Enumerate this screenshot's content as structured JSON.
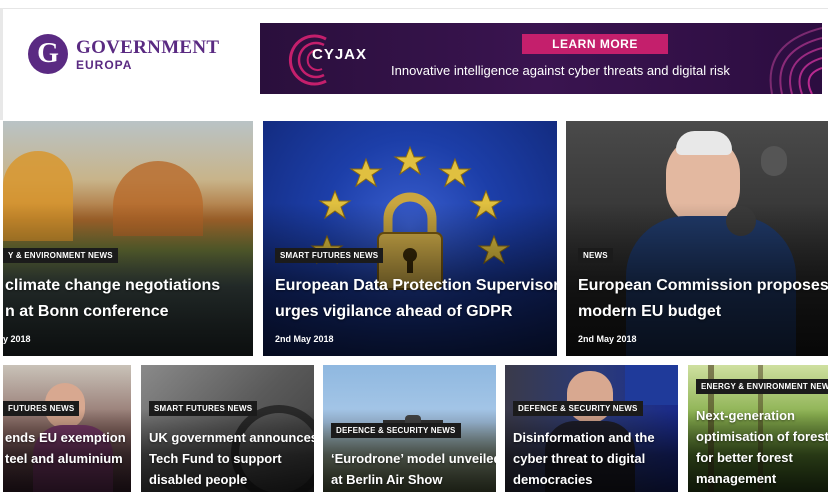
{
  "logo": {
    "letter": "G",
    "main": "GOVERNMENT",
    "sub": "EUROPA"
  },
  "banner": {
    "brand": "CYJAX",
    "button_label": "LEARN MORE",
    "tagline": "Innovative intelligence against cyber threats and digital risk",
    "accent": "#c41f6c",
    "bg": "#2a0f3c"
  },
  "brand_color": "#5a2a82",
  "featured": [
    {
      "category": "Y & ENVIRONMENT NEWS",
      "line1": "climate change negotiations",
      "line2": "n at Bonn conference",
      "date": "y 2018"
    },
    {
      "category": "SMART FUTURES NEWS",
      "line1": "European Data Protection Supervisor",
      "line2": "urges vigilance ahead of GDPR",
      "date": "2nd May 2018"
    },
    {
      "category": "NEWS",
      "line1": "European Commission proposes a",
      "line2": "modern EU budget",
      "date": "2nd May 2018"
    }
  ],
  "secondary": [
    {
      "category": "FUTURES NEWS",
      "line1": "ends EU exemption",
      "line2": "teel and aluminium",
      "line3": ""
    },
    {
      "category": "SMART FUTURES NEWS",
      "line1": "UK government announces",
      "line2": "Tech Fund to support",
      "line3": "disabled people"
    },
    {
      "category": "DEFENCE & SECURITY NEWS",
      "line1": "‘Eurodrone’ model unveiled",
      "line2": "at Berlin Air Show",
      "line3": ""
    },
    {
      "category": "DEFENCE & SECURITY NEWS",
      "line1": "Disinformation and the",
      "line2": "cyber threat to digital",
      "line3": "democracies"
    },
    {
      "category": "ENERGY & ENVIRONMENT NEWS",
      "line1": "Next-generation",
      "line2": "optimisation of forest da",
      "line3": "for better forest",
      "line4": "management"
    }
  ]
}
